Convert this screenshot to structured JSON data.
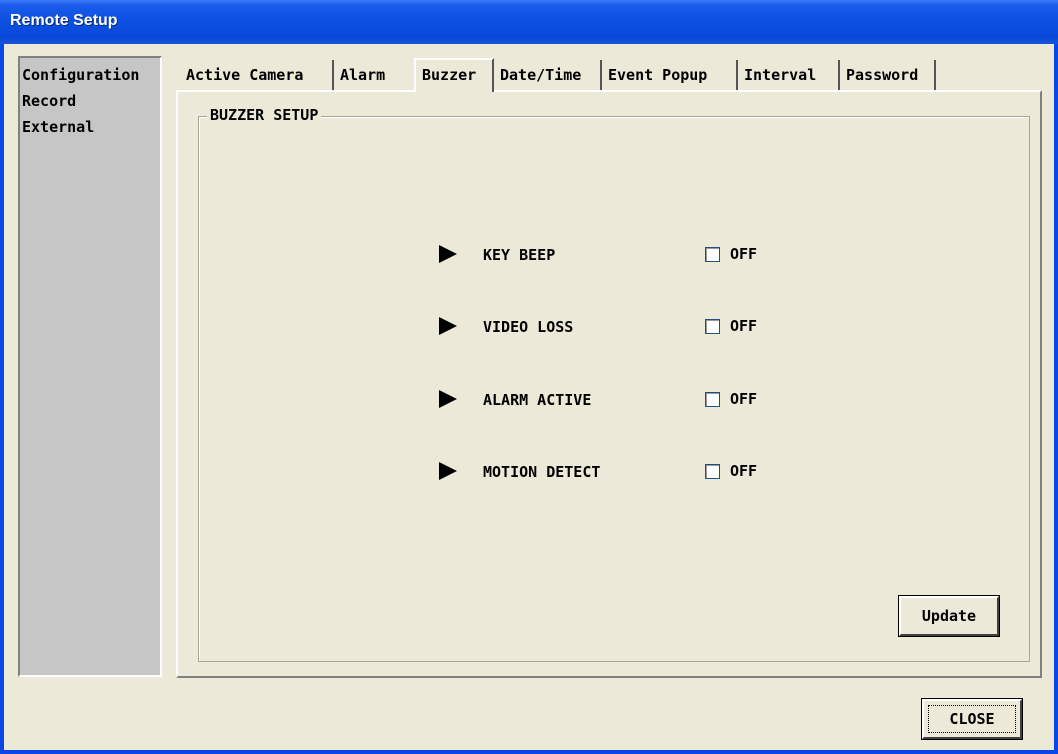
{
  "window": {
    "title": "Remote Setup"
  },
  "sidebar": {
    "items": [
      {
        "label": "Configuration"
      },
      {
        "label": "Record"
      },
      {
        "label": "External"
      }
    ]
  },
  "tabs": [
    {
      "label": "Active Camera"
    },
    {
      "label": "Alarm"
    },
    {
      "label": "Buzzer",
      "active": true
    },
    {
      "label": "Date/Time"
    },
    {
      "label": "Event Popup"
    },
    {
      "label": "Interval"
    },
    {
      "label": "Password"
    }
  ],
  "buzzer": {
    "group_title": "BUZZER SETUP",
    "rows": [
      {
        "label": "KEY BEEP",
        "checked": false,
        "state": "OFF"
      },
      {
        "label": "VIDEO LOSS",
        "checked": false,
        "state": "OFF"
      },
      {
        "label": "ALARM ACTIVE",
        "checked": false,
        "state": "OFF"
      },
      {
        "label": "MOTION DETECT",
        "checked": false,
        "state": "OFF"
      }
    ],
    "update_label": "Update"
  },
  "footer": {
    "close_label": "CLOSE"
  }
}
